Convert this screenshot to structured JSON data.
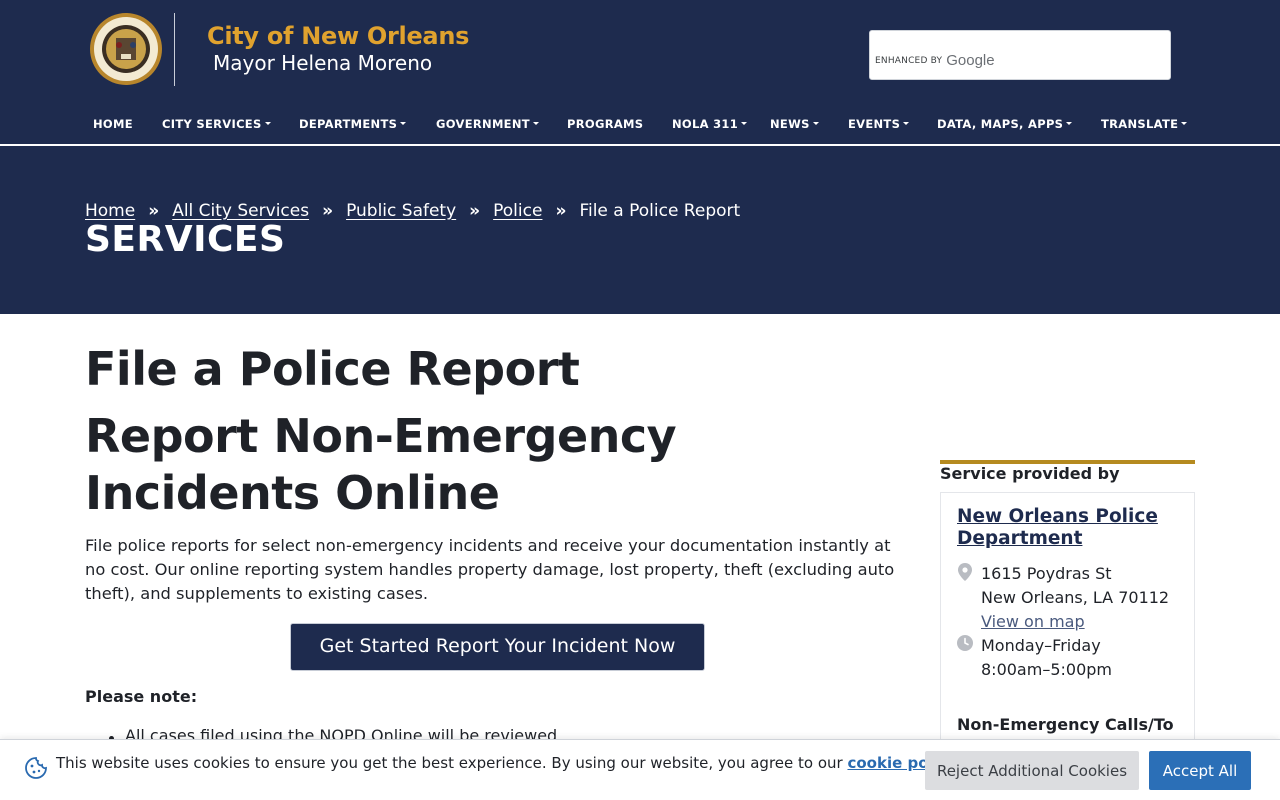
{
  "header": {
    "title": "City of New Orleans",
    "subtitle": "Mayor Helena Moreno",
    "seal_icon": "city-seal",
    "search": {
      "enhanced_by": "ENHANCED BY",
      "brand": "Google"
    }
  },
  "nav": {
    "items": [
      {
        "label": "HOME",
        "dropdown": false
      },
      {
        "label": "CITY SERVICES",
        "dropdown": true
      },
      {
        "label": "DEPARTMENTS",
        "dropdown": true
      },
      {
        "label": "GOVERNMENT",
        "dropdown": true
      },
      {
        "label": "PROGRAMS",
        "dropdown": false
      },
      {
        "label": "NOLA 311",
        "dropdown": true
      },
      {
        "label": "NEWS",
        "dropdown": true
      },
      {
        "label": "EVENTS",
        "dropdown": true
      },
      {
        "label": "DATA, MAPS, APPS",
        "dropdown": true
      },
      {
        "label": "TRANSLATE",
        "dropdown": true
      }
    ]
  },
  "breadcrumb": {
    "items": [
      "Home",
      "All City Services",
      "Public Safety",
      "Police"
    ],
    "separator": "»",
    "current": "File a Police Report"
  },
  "hero": {
    "title": "SERVICES"
  },
  "main": {
    "title": "File a Police Report",
    "subtitle": "Report Non-Emergency Incidents Online",
    "intro": "File police reports for select non-emergency incidents and receive your documentation instantly at no cost. Our online reporting system handles property damage, lost property, theft (excluding auto theft), and supplements to existing cases.",
    "cta_label": "Get Started Report Your Incident Now",
    "note_label": "Please note:",
    "notes": [
      "All cases filed using the NOPD Online will be reviewed"
    ]
  },
  "sidebar": {
    "heading": "Service provided by",
    "department": "New Orleans Police Department",
    "address_line1": "1615 Poydras St",
    "address_line2": "New Orleans, LA 70112",
    "map_link": "View on map",
    "hours_days": "Monday–Friday",
    "hours_time": "8:00am–5:00pm",
    "calls_label": "Non-Emergency Calls/To"
  },
  "cookie": {
    "text": "This website uses cookies to ensure you get the best experience. By using our website, you agree to our",
    "link": "cookie policy",
    "trailing": ".",
    "reject_label": "Reject Additional Cookies",
    "accept_label": "Accept All"
  },
  "colors": {
    "navy": "#1e2b4e",
    "gold": "#e0a22e",
    "accent_bar": "#b58a1f",
    "link_blue": "#2a6ab0",
    "accept_blue": "#2b6fb7"
  }
}
